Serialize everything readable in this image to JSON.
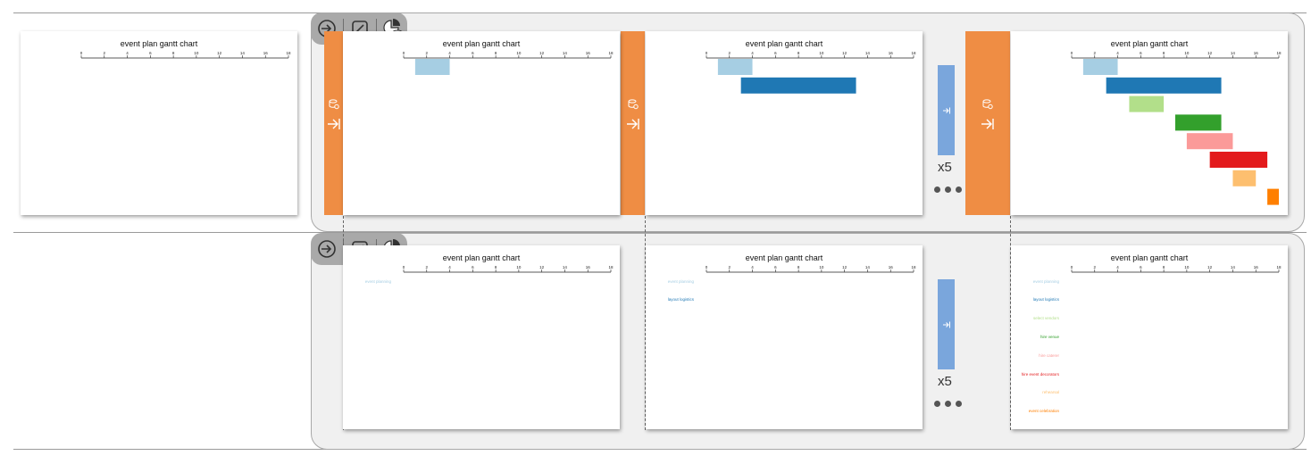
{
  "chart_title": "event plan gantt chart",
  "axis": {
    "ticks": [
      0,
      2,
      4,
      6,
      8,
      10,
      12,
      14,
      16,
      18
    ],
    "min": 0,
    "max": 18
  },
  "tasks": [
    {
      "name": "event planning",
      "start": 1,
      "end": 4,
      "color": "#a6cee3"
    },
    {
      "name": "layout logistics",
      "start": 3,
      "end": 13,
      "color": "#1f78b4"
    },
    {
      "name": "select vendors",
      "start": 5,
      "end": 8,
      "color": "#b2df8a"
    },
    {
      "name": "hire venue",
      "start": 9,
      "end": 13,
      "color": "#33a02c"
    },
    {
      "name": "hire caterer",
      "start": 10,
      "end": 14,
      "color": "#fb9a99"
    },
    {
      "name": "hire event decorators",
      "start": 12,
      "end": 17,
      "color": "#e31a1c"
    },
    {
      "name": "rehearsal",
      "start": 14,
      "end": 16,
      "color": "#fdbf6f"
    },
    {
      "name": "event celebration",
      "start": 17,
      "end": 18,
      "color": "#ff7f00"
    }
  ],
  "repeat_label": "x5",
  "colors": {
    "orange_accent": "#ef8d44",
    "blue_accent": "#7aa6dc"
  },
  "icons": [
    "enter-icon",
    "slash-tool-icon",
    "pie-database-icon",
    "database-refresh-icon",
    "arrow-to-bar-icon"
  ]
}
